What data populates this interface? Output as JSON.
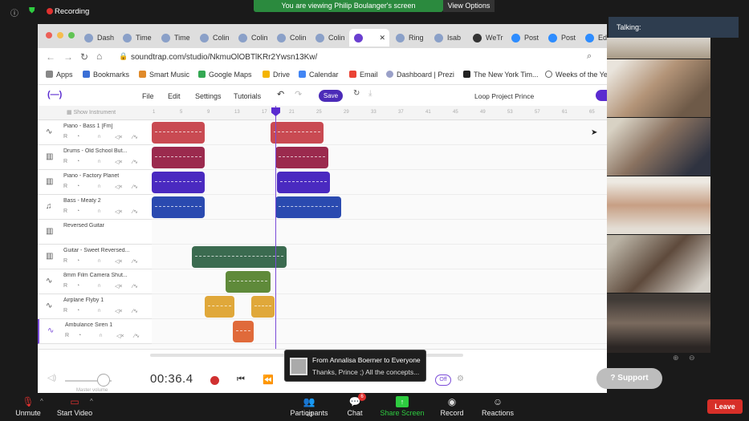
{
  "zoom_top": {
    "recording": "Recording",
    "viewing": "You are viewing Philip Boulanger's screen",
    "view_options": "View Options"
  },
  "browser": {
    "tabs": [
      "Dash",
      "Time",
      "Time",
      "Colin",
      "Colin",
      "Colin",
      "Colin",
      "",
      "Ring",
      "Isab",
      "WeTr",
      "Post",
      "Post",
      "Edit"
    ],
    "url": "soundtrap.com/studio/NkmuOlOBTlKRr2Ywsn13Kw/",
    "bookmarks": [
      "Apps",
      "Bookmarks",
      "Smart Music",
      "Google Maps",
      "Drive",
      "Calendar",
      "Email",
      "Dashboard | Prezi",
      "The New York Tim...",
      "Weeks of the Ye"
    ]
  },
  "soundtrap": {
    "menu": [
      "File",
      "Edit",
      "Settings",
      "Tutorials"
    ],
    "save_label": "Save",
    "project_title": "Loop Project Prince",
    "show_instrument": "Show Instrument",
    "ruler": [
      "1",
      "5",
      "9",
      "13",
      "17",
      "21",
      "25",
      "29",
      "33",
      "37",
      "41",
      "45",
      "49",
      "53",
      "57",
      "61",
      "65"
    ],
    "tracks": [
      {
        "name": "Piano - Bass 1 [Fm]",
        "icon": "wave"
      },
      {
        "name": "Drums - Old School But...",
        "icon": "keys"
      },
      {
        "name": "Piano - Factory Planet",
        "icon": "keys"
      },
      {
        "name": "Bass - Meaty 2",
        "icon": "guitar"
      },
      {
        "name": "Reversed Guitar",
        "icon": "keys"
      },
      {
        "name": "Guitar - Sweet Reversed...",
        "icon": "keys"
      },
      {
        "name": "8mm Film Camera Shut...",
        "icon": "wave"
      },
      {
        "name": "Airplane Flyby 1",
        "icon": "wave"
      },
      {
        "name": "Ambulance Siren 1",
        "icon": "wave"
      }
    ],
    "time": "00:36.4",
    "off_label": "Off",
    "master_volume": "Master volume",
    "support": "Support"
  },
  "chat_toast": {
    "from": "From Annalisa Boerner to Everyone",
    "message": "Thanks, Prince ;) All the concepts..."
  },
  "side": {
    "talking": "Talking:"
  },
  "zoom_bottom": {
    "unmute": "Unmute",
    "start_video": "Start Video",
    "participants": "Participants",
    "participants_count": "82",
    "chat": "Chat",
    "chat_badge": "6",
    "share": "Share Screen",
    "record": "Record",
    "reactions": "Reactions",
    "leave": "Leave"
  }
}
